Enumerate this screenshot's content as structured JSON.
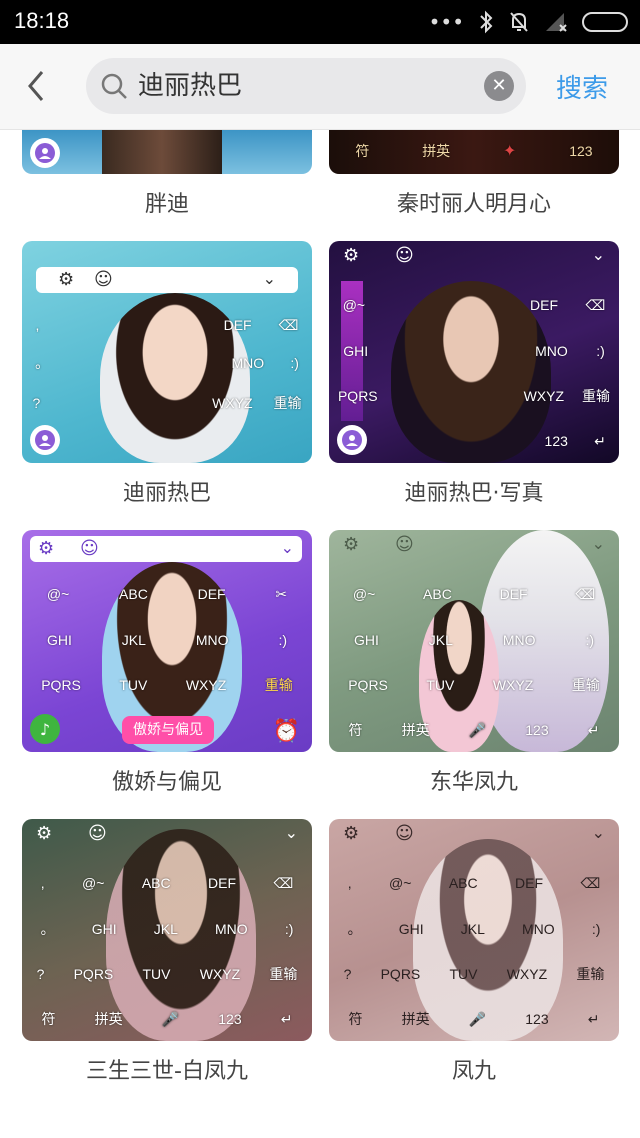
{
  "status_bar": {
    "time": "18:18"
  },
  "search": {
    "query": "迪丽热巴",
    "submit_label": "搜索"
  },
  "themes": [
    {
      "name": "胖迪"
    },
    {
      "name": "秦时丽人明月心"
    },
    {
      "name": "迪丽热巴"
    },
    {
      "name": "迪丽热巴·写真"
    },
    {
      "name": "傲娇与偏见"
    },
    {
      "name": "东华凤九"
    },
    {
      "name": "三生三世-白凤九"
    },
    {
      "name": "凤九"
    }
  ],
  "keyboard": {
    "row1": [
      ",",
      "@~",
      "ABC",
      "DEF"
    ],
    "row2": [
      "。",
      "GHI",
      "JKL",
      "MNO",
      ":)"
    ],
    "row3": [
      "?",
      "PQRS",
      "TUV",
      "WXYZ",
      "重输"
    ],
    "row4": [
      "符",
      "拼英",
      "123"
    ],
    "banner": "傲娇与偏见"
  },
  "colors": {
    "accent": "#3d9be9"
  }
}
